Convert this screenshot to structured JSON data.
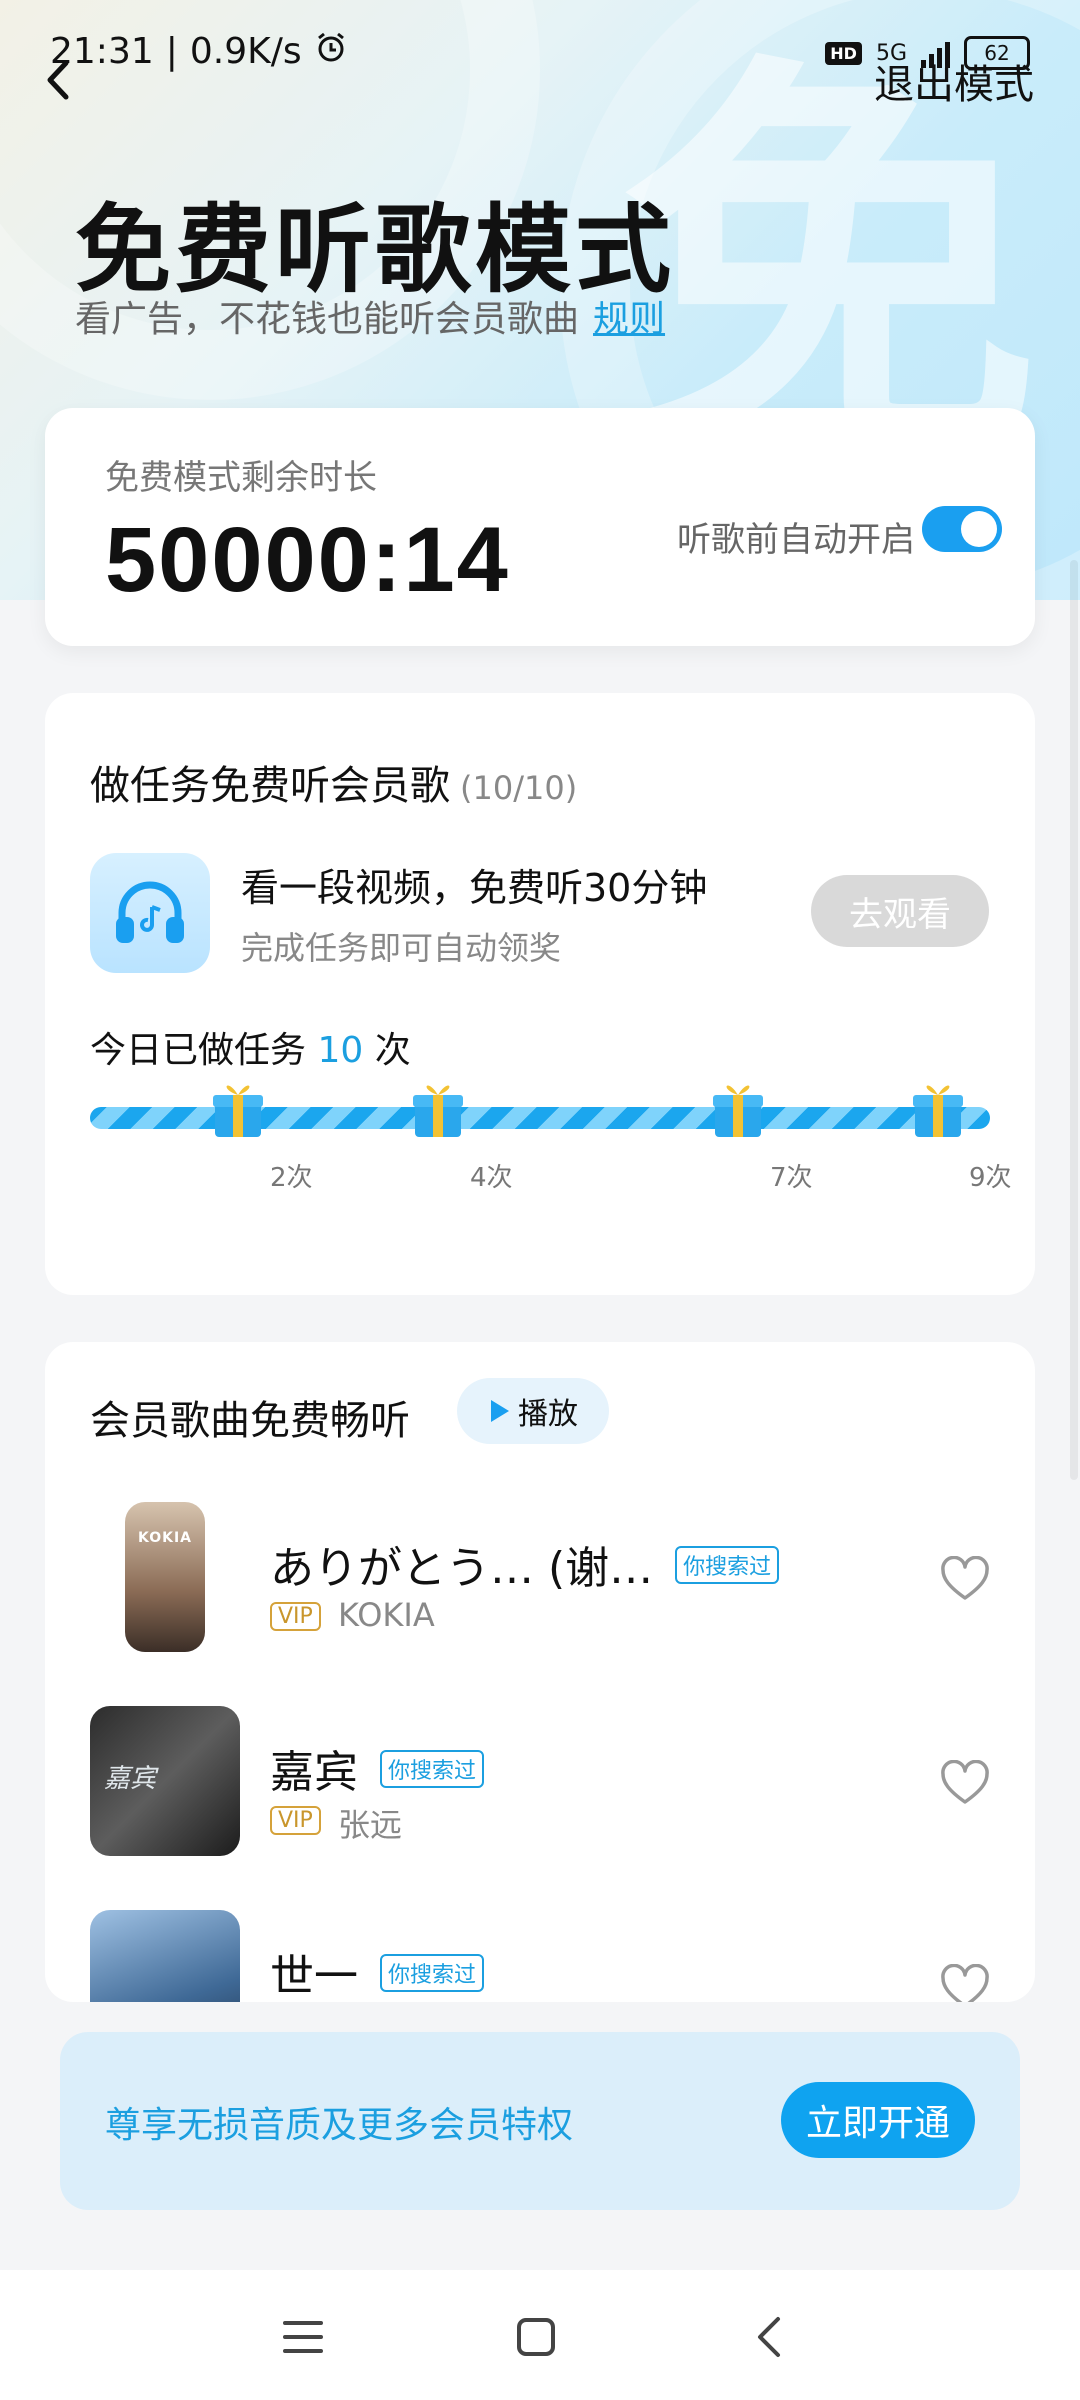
{
  "status": {
    "time": "21:31",
    "speed": "0.9K/s",
    "hd": "HD",
    "network": "5G",
    "battery": "62"
  },
  "header": {
    "exit_label": "退出模式",
    "title": "免费听歌模式",
    "subtitle": "看广告，不花钱也能听会员歌曲",
    "rules_link": "规则",
    "bg_char": "免"
  },
  "timer": {
    "label": "免费模式剩余时长",
    "value": "50000:14",
    "auto_label": "听歌前自动开启",
    "auto_on": true
  },
  "tasks": {
    "title": "做任务免费听会员歌",
    "count": "(10/10)",
    "item_title": "看一段视频，免费听30分钟",
    "item_sub": "完成任务即可自动领奖",
    "watch_button": "去观看",
    "done_prefix": "今日已做任务",
    "done_count": "10",
    "done_suffix": "次",
    "progress": 1.0,
    "steps": [
      "2次",
      "4次",
      "7次",
      "9次"
    ]
  },
  "songs": {
    "title": "会员歌曲免费畅听",
    "play_label": "播放",
    "items": [
      {
        "name": "ありがとう… (谢…",
        "tag": "你搜索过",
        "vip": "VIP",
        "artist": "KOKIA",
        "cover_text": "KOKIA"
      },
      {
        "name": "嘉宾",
        "tag": "你搜索过",
        "vip": "VIP",
        "artist": "张远",
        "cover_text": "嘉宾"
      },
      {
        "name": "世一",
        "tag": "你搜索过",
        "vip": "",
        "artist": "",
        "cover_text": ""
      }
    ]
  },
  "vip_banner": {
    "text": "尊享无损音质及更多会员特权",
    "button": "立即开通"
  },
  "colors": {
    "accent": "#1b9fe0",
    "vip": "#c9962c",
    "toggle": "#1a9ff0"
  }
}
